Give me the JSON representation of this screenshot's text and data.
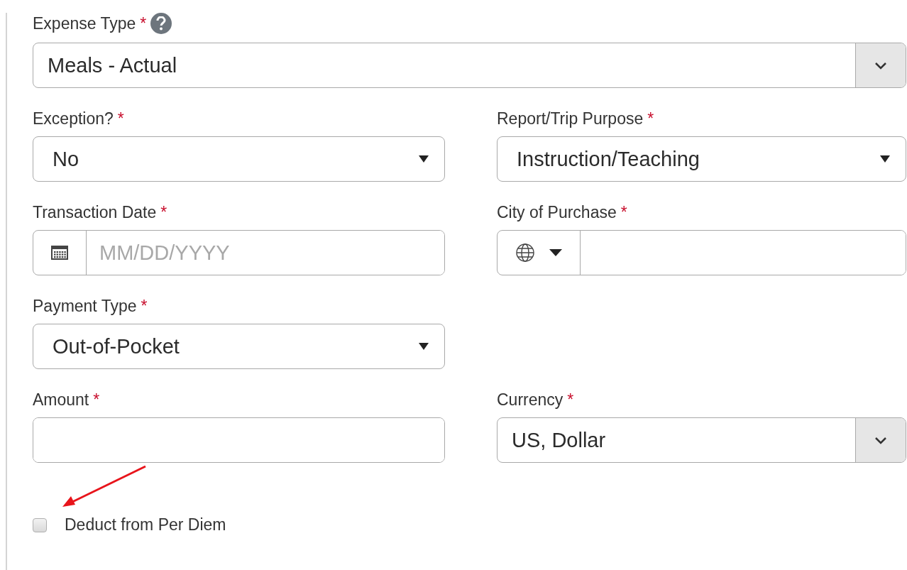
{
  "rows": [
    {
      "fields": [
        {
          "kind": "combo",
          "label": "Expense Type",
          "required": true,
          "help": true,
          "value": "Meals - Actual"
        }
      ]
    },
    {
      "fields": [
        {
          "kind": "select",
          "label": "Exception?",
          "required": true,
          "help": false,
          "value": "No"
        },
        {
          "kind": "select",
          "label": "Report/Trip Purpose",
          "required": true,
          "help": false,
          "value": "Instruction/Teaching"
        }
      ]
    },
    {
      "fields": [
        {
          "kind": "date",
          "label": "Transaction Date",
          "required": true,
          "help": false,
          "placeholder": "MM/DD/YYYY"
        },
        {
          "kind": "city",
          "label": "City of Purchase",
          "required": true,
          "help": false
        }
      ]
    },
    {
      "fields": [
        {
          "kind": "select",
          "label": "Payment Type",
          "required": true,
          "help": false,
          "value": "Out-of-Pocket"
        }
      ]
    },
    {
      "fields": [
        {
          "kind": "text",
          "label": "Amount",
          "required": true,
          "help": false
        },
        {
          "kind": "combo",
          "label": "Currency",
          "required": true,
          "help": false,
          "value": "US, Dollar"
        }
      ]
    }
  ],
  "required_mark": "*",
  "checkbox": {
    "label": "Deduct from Per Diem",
    "checked": false
  }
}
